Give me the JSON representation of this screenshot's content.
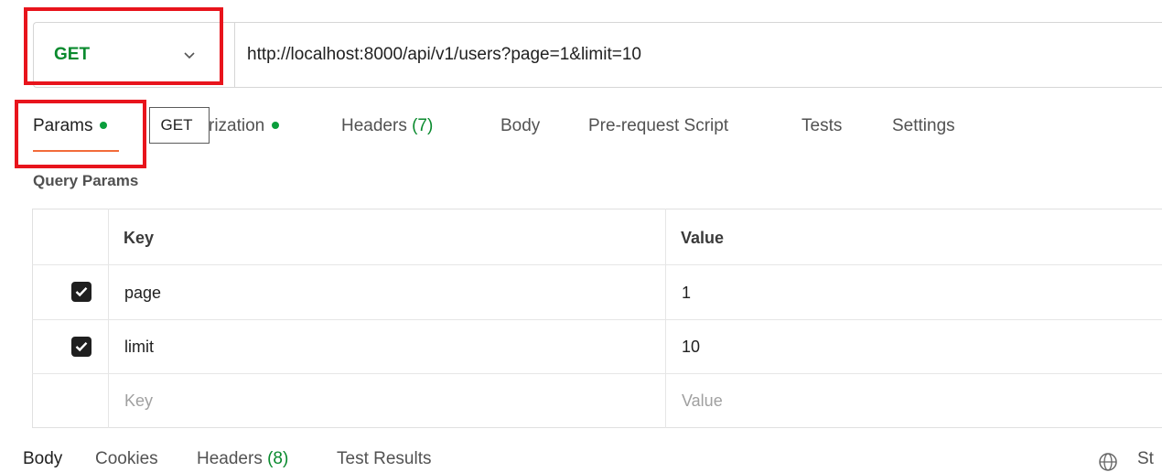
{
  "request": {
    "method": "GET",
    "url": "http://localhost:8000/api/v1/users?page=1&limit=10"
  },
  "tabs": [
    {
      "label": "Params",
      "dot": true,
      "active": true
    },
    {
      "label": "rization",
      "dot": true
    },
    {
      "label": "Headers",
      "count": "(7)"
    },
    {
      "label": "Body"
    },
    {
      "label": "Pre-request Script"
    },
    {
      "label": "Tests"
    },
    {
      "label": "Settings"
    }
  ],
  "tooltip": "GET",
  "query_params": {
    "title": "Query Params",
    "columns": {
      "key": "Key",
      "value": "Value"
    },
    "rows": [
      {
        "checked": true,
        "key": "page",
        "value": "1"
      },
      {
        "checked": true,
        "key": "limit",
        "value": "10"
      }
    ],
    "placeholder": {
      "key": "Key",
      "value": "Value"
    }
  },
  "response_tabs": [
    {
      "label": "Body"
    },
    {
      "label": "Cookies"
    },
    {
      "label": "Headers",
      "count": "(8)"
    },
    {
      "label": "Test Results"
    }
  ],
  "status_fragment": "St",
  "colors": {
    "method": "#0a8a2e",
    "accent": "#f26b3a",
    "highlight": "#e8141c",
    "dot": "#0a9e3c"
  },
  "icons": {
    "method_dropdown": "chevron-down-icon",
    "response_status": "globe-icon"
  }
}
